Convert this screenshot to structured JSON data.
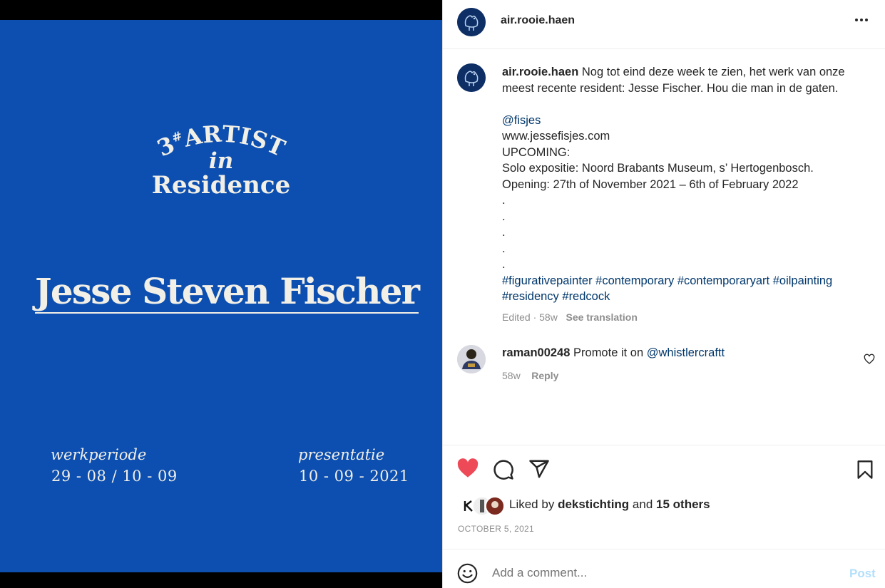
{
  "poster": {
    "number": "3",
    "number_sup": "#",
    "artist": "ARTIST",
    "in": "in",
    "residence": "Residence",
    "name": "Jesse Steven Fischer",
    "work_label": "werkperiode",
    "work_value": "29 - 08 / 10 - 09",
    "pres_label": "presentatie",
    "pres_value": "10 - 09 - 2021"
  },
  "header": {
    "username": "air.rooie.haen",
    "more_icon": "more-horizontal-icon"
  },
  "caption": {
    "username": "air.rooie.haen",
    "text1": "Nog tot eind deze week te zien, het werk van onze meest recente resident: Jesse Fischer. Hou die man in de gaten.",
    "mention": "@fisjes",
    "website": "www.jessefisjes.com",
    "upcoming": "UPCOMING:",
    "solo": "Solo expositie: Noord Brabants Museum, s’ Hertogenbosch.",
    "opening": "Opening: 27th of November 2021 – 6th of February 2022",
    "dots": [
      ".",
      ".",
      ".",
      ".",
      "."
    ],
    "hashtags": [
      "#figurativepainter",
      "#contemporary",
      "#contemporaryart",
      "#oilpainting",
      "#residency",
      "#redcock"
    ],
    "edited": "Edited · 58w",
    "see_translation": "See translation"
  },
  "comment": {
    "username": "raman00248",
    "text": "Promote it on",
    "mention": "@whistlercraftt",
    "age": "58w",
    "reply": "Reply"
  },
  "likes": {
    "prefix": "Liked by",
    "user": "dekstichting",
    "and": "and",
    "others": "15 others"
  },
  "date": "OCTOBER 5, 2021",
  "add_comment": {
    "placeholder": "Add a comment...",
    "post": "Post"
  },
  "colors": {
    "poster_blue": "#0c4fb0",
    "like_red": "#ed4956",
    "link_blue": "#00376b",
    "post_disabled": "#b2dffc"
  }
}
